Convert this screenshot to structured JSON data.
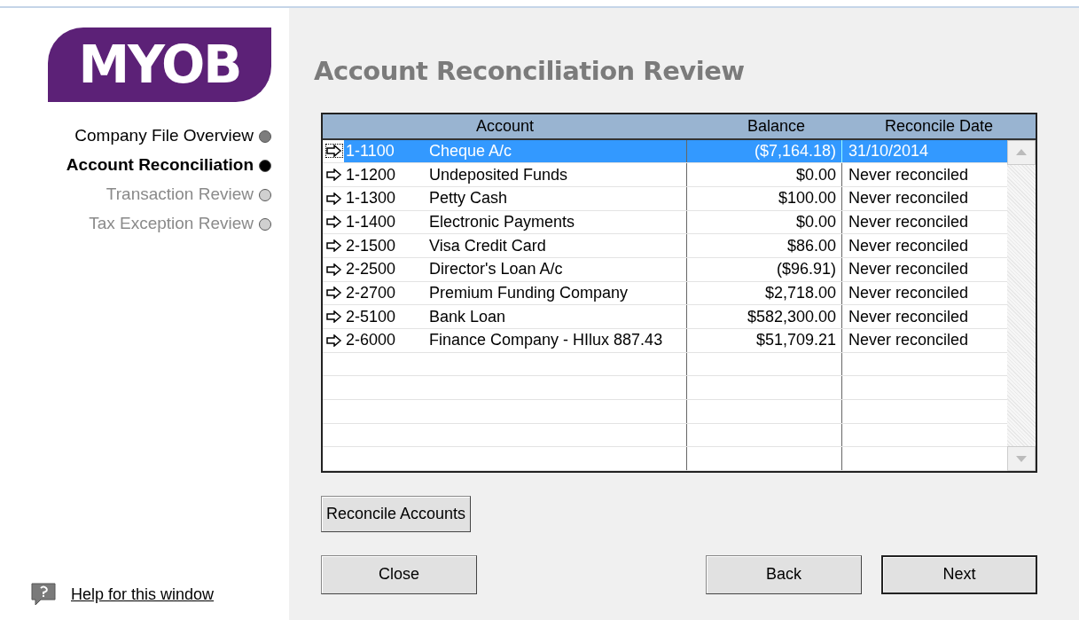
{
  "logo": {
    "text": "MYOB"
  },
  "steps": [
    {
      "label": "Company File Overview",
      "kind": "done"
    },
    {
      "label": "Account Reconciliation",
      "kind": "current"
    },
    {
      "label": "Transaction Review",
      "kind": "pending"
    },
    {
      "label": "Tax Exception Review",
      "kind": "pending"
    }
  ],
  "help_link": "Help for this window",
  "title": "Account Reconciliation Review",
  "table": {
    "columns": [
      "Account",
      "Balance",
      "Reconcile Date"
    ],
    "rows": [
      {
        "code": "1-1100",
        "name": "Cheque A/c",
        "balance": "($7,164.18)",
        "date": "31/10/2014",
        "selected": true
      },
      {
        "code": "1-1200",
        "name": "Undeposited Funds",
        "balance": "$0.00",
        "date": "Never reconciled",
        "selected": false
      },
      {
        "code": "1-1300",
        "name": "Petty Cash",
        "balance": "$100.00",
        "date": "Never reconciled",
        "selected": false
      },
      {
        "code": "1-1400",
        "name": "Electronic Payments",
        "balance": "$0.00",
        "date": "Never reconciled",
        "selected": false
      },
      {
        "code": "2-1500",
        "name": "Visa Credit Card",
        "balance": "$86.00",
        "date": "Never reconciled",
        "selected": false
      },
      {
        "code": "2-2500",
        "name": "Director's Loan A/c",
        "balance": "($96.91)",
        "date": "Never reconciled",
        "selected": false
      },
      {
        "code": "2-2700",
        "name": "Premium Funding Company",
        "balance": "$2,718.00",
        "date": "Never reconciled",
        "selected": false
      },
      {
        "code": "2-5100",
        "name": "Bank Loan",
        "balance": "$582,300.00",
        "date": "Never reconciled",
        "selected": false
      },
      {
        "code": "2-6000",
        "name": "Finance Company - HIlux 887.43",
        "balance": "$51,709.21",
        "date": "Never reconciled",
        "selected": false
      }
    ]
  },
  "reconcile_button": "Reconcile Accounts",
  "buttons": {
    "close": "Close",
    "back": "Back",
    "next": "Next"
  }
}
